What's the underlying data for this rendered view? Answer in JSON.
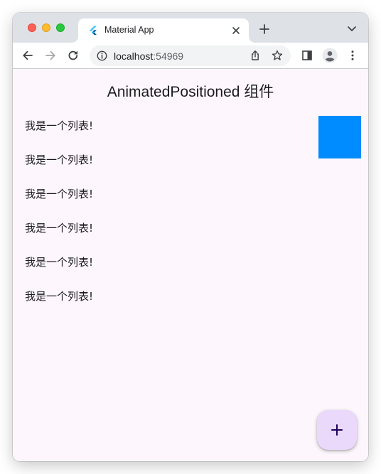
{
  "browser": {
    "tab": {
      "title": "Material App",
      "favicon": "flutter-icon"
    },
    "address": {
      "host": "localhost",
      "port": ":54969"
    },
    "icons": [
      "back-icon",
      "forward-icon",
      "reload-icon",
      "info-icon",
      "share-icon",
      "star-icon",
      "sidepanel-icon",
      "profile-icon",
      "menu-icon",
      "new-tab-icon",
      "tab-search-icon",
      "close-icon"
    ]
  },
  "app": {
    "title": "AnimatedPositioned 组件",
    "list": [
      {
        "label": "我是一个列表!"
      },
      {
        "label": "我是一个列表!"
      },
      {
        "label": "我是一个列表!"
      },
      {
        "label": "我是一个列表!"
      },
      {
        "label": "我是一个列表!"
      },
      {
        "label": "我是一个列表!"
      }
    ],
    "box_color": "#008cff",
    "fab": {
      "icon": "add-icon",
      "color": "#ead9fb"
    }
  }
}
